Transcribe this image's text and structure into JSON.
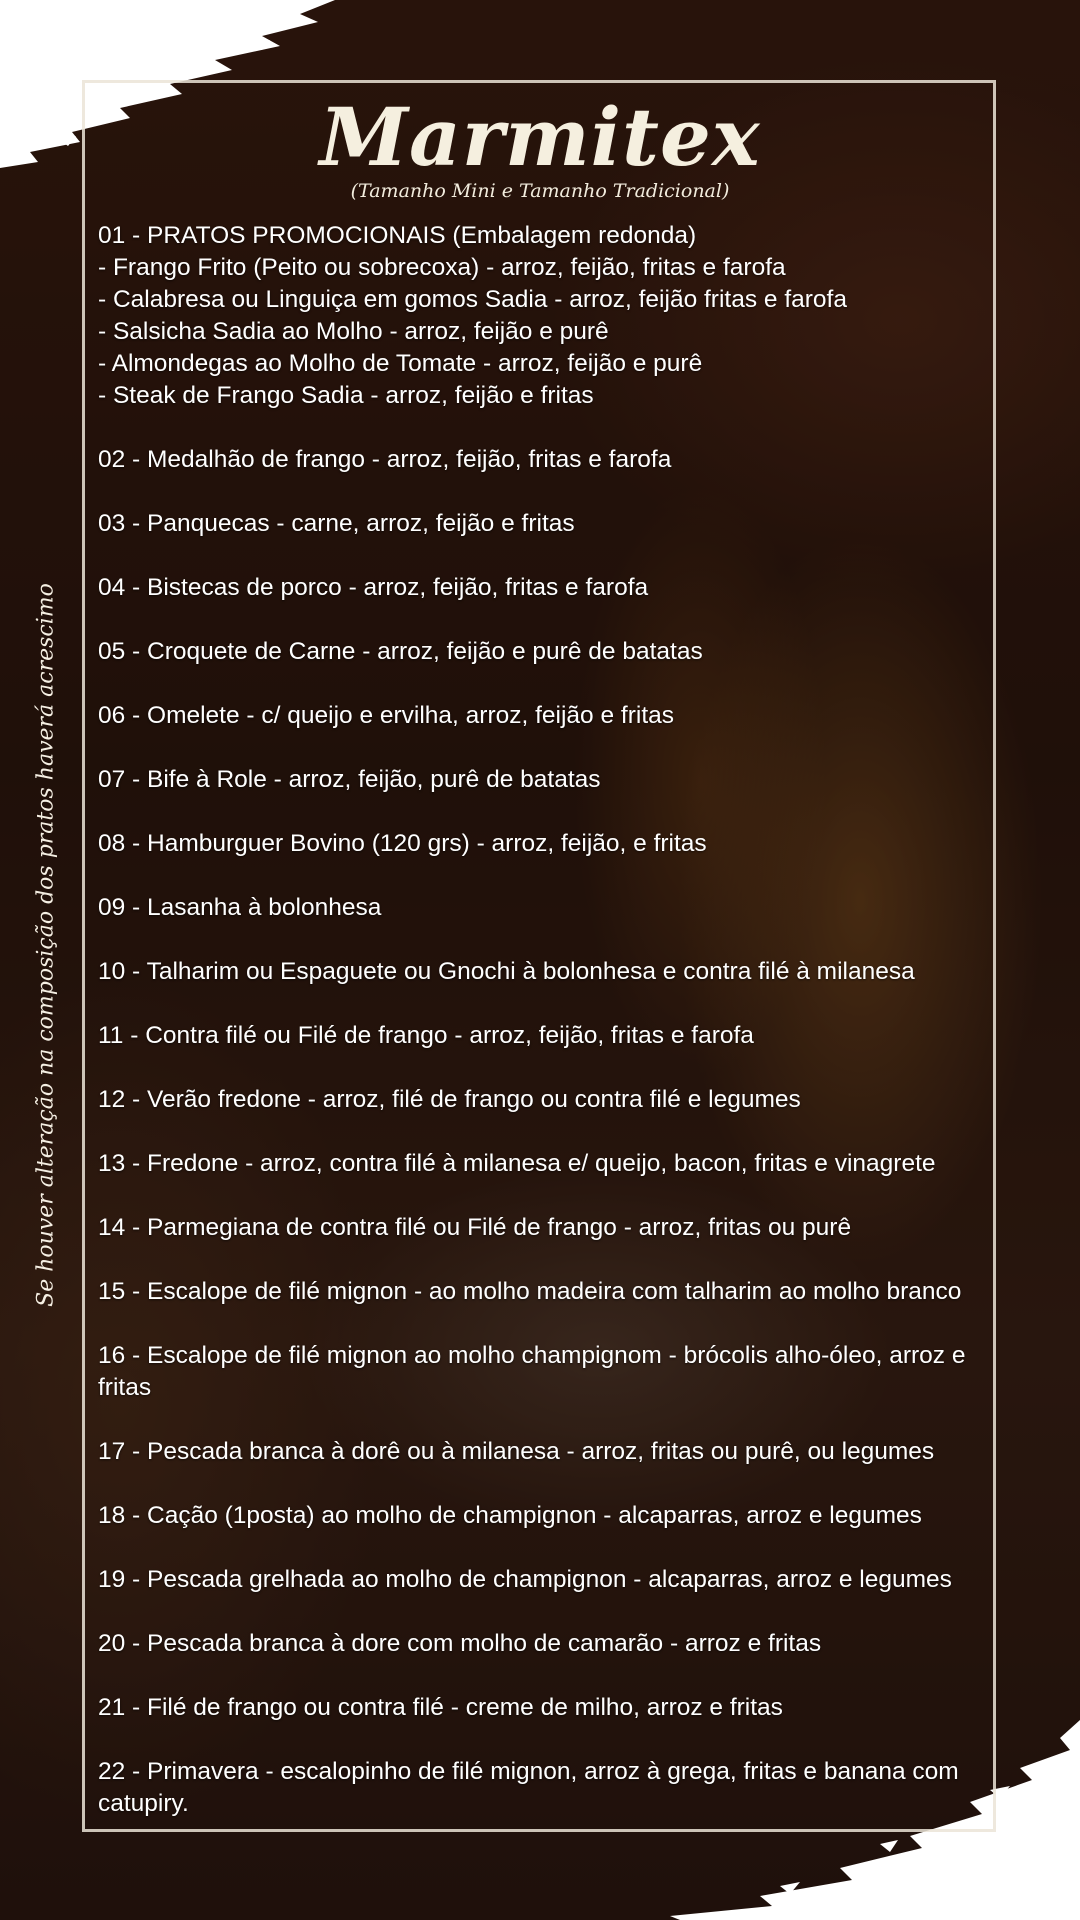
{
  "menu_title": "Marmitex",
  "menu_subtitle": "(Tamanho Mini e Tamanho Tradicional)",
  "promo": {
    "heading": "01 - PRATOS PROMOCIONAIS (Embalagem redonda)",
    "items": [
      " - Frango Frito (Peito ou sobrecoxa) - arroz, feijão, fritas e farofa",
      " - Calabresa ou Linguiça em gomos Sadia - arroz, feijão fritas e farofa",
      " - Salsicha Sadia ao Molho - arroz, feijão e purê",
      " - Almondegas ao Molho de Tomate - arroz, feijão e purê",
      " - Steak de Frango Sadia - arroz, feijão e fritas"
    ]
  },
  "items": [
    "02 - Medalhão de frango - arroz, feijão, fritas e farofa",
    "03 - Panquecas - carne, arroz, feijão e fritas",
    "04 - Bistecas de porco - arroz, feijão, fritas e farofa",
    "05 - Croquete de Carne - arroz, feijão e purê de batatas",
    "06 - Omelete - c/ queijo e ervilha, arroz, feijão e fritas",
    "07 - Bife à Role - arroz, feijão, purê de batatas",
    "08 - Hamburguer Bovino (120 grs) - arroz, feijão, e fritas",
    "09 - Lasanha à bolonhesa",
    "10 - Talharim ou Espaguete ou Gnochi à bolonhesa e contra filé à milanesa",
    "11 - Contra filé ou Filé de frango - arroz, feijão, fritas e farofa",
    "12 - Verão fredone - arroz, filé de frango ou contra filé e legumes",
    "13 - Fredone - arroz, contra filé à milanesa e/ queijo, bacon, fritas e vinagrete",
    "14 - Parmegiana  de  contra filé ou Filé de frango - arroz, fritas ou purê",
    "15 - Escalope de filé mignon - ao molho madeira com talharim ao molho branco",
    "16 - Escalope de filé mignon ao molho champignom - brócolis alho-óleo, arroz e fritas",
    "17 - Pescada branca à dorê ou à milanesa - arroz, fritas ou purê, ou legumes",
    "18 - Cação (1posta) ao molho de champignon - alcaparras, arroz e legumes",
    "19 - Pescada grelhada ao molho de champignon - alcaparras, arroz e legumes",
    "20 - Pescada branca à dore com molho de camarão - arroz e fritas",
    "21 - Filé de frango ou contra filé - creme de milho, arroz e fritas",
    "22 - Primavera - escalopinho de filé mignon, arroz à grega, fritas e banana com catupiry."
  ],
  "side_note": "Se houver alteração na composição dos pratos haverá acrescimo",
  "colors": {
    "text": "#ffffff",
    "frame": "#ebe4d7",
    "background": "#2c170d"
  }
}
